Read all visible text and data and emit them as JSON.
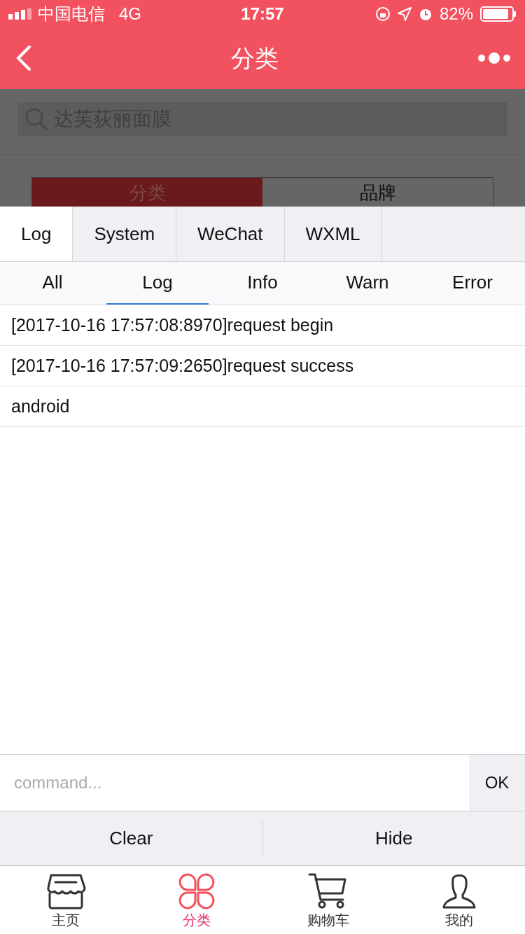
{
  "status_bar": {
    "carrier": "中国电信",
    "network": "4G",
    "time": "17:57",
    "battery": "82%"
  },
  "nav": {
    "title": "分类"
  },
  "search": {
    "placeholder": "达芙荻丽面膜"
  },
  "segments": [
    {
      "label": "分类",
      "selected": true
    },
    {
      "label": "品牌",
      "selected": false
    }
  ],
  "console": {
    "tabs": [
      {
        "label": "Log",
        "selected": true
      },
      {
        "label": "System",
        "selected": false
      },
      {
        "label": "WeChat",
        "selected": false
      },
      {
        "label": "WXML",
        "selected": false
      }
    ],
    "filters": [
      {
        "label": "All",
        "selected": false
      },
      {
        "label": "Log",
        "selected": true
      },
      {
        "label": "Info",
        "selected": false
      },
      {
        "label": "Warn",
        "selected": false
      },
      {
        "label": "Error",
        "selected": false
      }
    ],
    "logs": [
      "[2017-10-16 17:57:08:8970]request begin",
      "[2017-10-16 17:57:09:2650]request success",
      "android"
    ],
    "command": {
      "placeholder": "command...",
      "button": "OK"
    },
    "actions": [
      "Clear",
      "Hide"
    ]
  },
  "tab_bar": [
    {
      "label": "主页",
      "kind": "home",
      "selected": false
    },
    {
      "label": "分类",
      "kind": "category",
      "selected": true
    },
    {
      "label": "购物车",
      "kind": "cart",
      "selected": false
    },
    {
      "label": "我的",
      "kind": "profile",
      "selected": false
    }
  ]
}
